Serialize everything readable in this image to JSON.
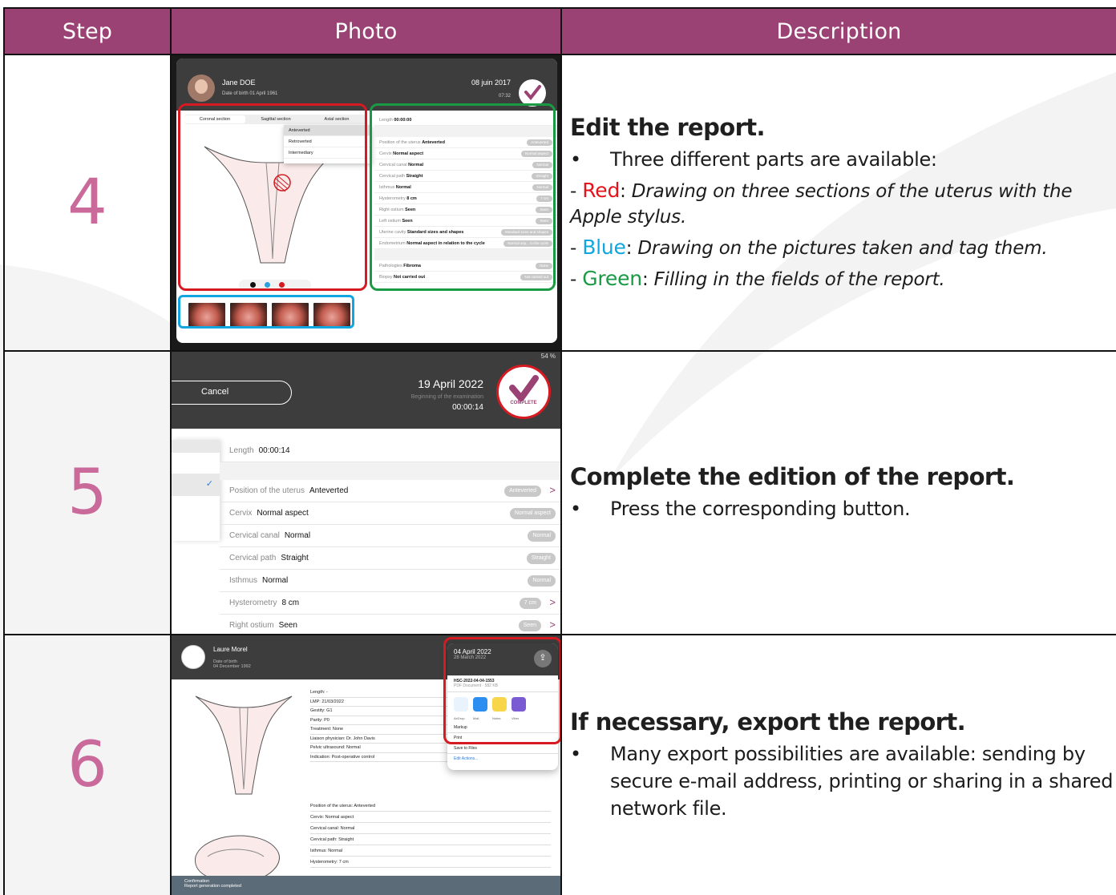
{
  "header": {
    "step": "Step",
    "photo": "Photo",
    "description": "Description"
  },
  "colors": {
    "header_bg": "#9b4274",
    "step_number": "#c96a9b",
    "red": "#e3141c",
    "blue": "#11a6df",
    "green": "#1a9a44"
  },
  "rows": [
    {
      "step": "4",
      "title": "Edit the report.",
      "bullet": "Three different parts are available:",
      "items": [
        {
          "keyword": "Red",
          "text": "Drawing on three sections of the uterus with the Apple stylus."
        },
        {
          "keyword": "Blue",
          "text": "Drawing on the pictures taken and tag them."
        },
        {
          "keyword": "Green",
          "text": "Filling in the fields of the report."
        }
      ],
      "screenshot": {
        "patient_name": "Jane DOE",
        "date_of_birth_label": "Date of birth",
        "date_of_birth": "01 April 1961",
        "exam_date": "08 juin 2017",
        "exam_time": "07:32",
        "tabs": [
          "Coronal section",
          "Sagittal section",
          "Axial section"
        ],
        "menu": [
          "Anteverted",
          "Retroverted",
          "Intermediary"
        ],
        "fields": [
          {
            "label": "Length",
            "value": "00:00:00",
            "pill": ""
          },
          {
            "label": "Position of the uterus",
            "value": "Anteverted",
            "pill": "Anteverted"
          },
          {
            "label": "Cervix",
            "value": "Normal aspect",
            "pill": "Normal aspect"
          },
          {
            "label": "Cervical canal",
            "value": "Normal",
            "pill": "Normal"
          },
          {
            "label": "Cervical path",
            "value": "Straight",
            "pill": "Straight"
          },
          {
            "label": "Isthmus",
            "value": "Normal",
            "pill": "Normal"
          },
          {
            "label": "Hysterometry",
            "value": "8 cm",
            "pill": "7 cm"
          },
          {
            "label": "Right ostium",
            "value": "Seen",
            "pill": "Seen"
          },
          {
            "label": "Left ostium",
            "value": "Seen",
            "pill": "Seen"
          },
          {
            "label": "Uterine cavity",
            "value": "Standard sizes and shapes",
            "pill": "Standard sizes and shapes"
          },
          {
            "label": "Endometrium",
            "value": "Normal aspect in relation to the cycle",
            "pill": "Normal asp... to the cycle"
          },
          {
            "label": "Pathologies",
            "value": "Fibroma",
            "pill": "None"
          },
          {
            "label": "Biopsy",
            "value": "Not carried out",
            "pill": "Not carried out"
          }
        ]
      }
    },
    {
      "step": "5",
      "title": "Complete the edition of the report.",
      "bullet": "Press the corresponding button.",
      "screenshot": {
        "status": "54 %",
        "cancel": "Cancel",
        "date": "19 April 2022",
        "sub": "Beginning of the examination",
        "time": "00:00:14",
        "complete": "COMPLETE",
        "fields": [
          {
            "label": "Length",
            "value": "00:00:14",
            "pill": ""
          },
          {
            "label": "Position of the uterus",
            "value": "Anteverted",
            "pill": "Anteverted"
          },
          {
            "label": "Cervix",
            "value": "Normal aspect",
            "pill": "Normal aspect"
          },
          {
            "label": "Cervical canal",
            "value": "Normal",
            "pill": "Normal"
          },
          {
            "label": "Cervical path",
            "value": "Straight",
            "pill": "Straight"
          },
          {
            "label": "Isthmus",
            "value": "Normal",
            "pill": "Normal"
          },
          {
            "label": "Hysterometry",
            "value": "8 cm",
            "pill": "7 cm"
          },
          {
            "label": "Right ostium",
            "value": "Seen",
            "pill": "Seen"
          }
        ]
      }
    },
    {
      "step": "6",
      "title": "If necessary, export the report.",
      "bullet": "Many export possibilities are available: sending by secure e-mail address, printing or sharing in a shared network file.",
      "screenshot": {
        "patient_name": "Laure Morel",
        "date_of_birth_label": "Date of birth",
        "date_of_birth": "04 December 1992",
        "sheet_date": "04 April 2022",
        "sheet_date2": "28 March 2022",
        "file_name": "HSC-2022-04-04-1553",
        "file_meta": "PDF Document · 582 KB",
        "apps": [
          "AirDrop",
          "Mail",
          "Notes",
          "Viber"
        ],
        "actions": [
          "Markup",
          "Print",
          "Save to Files",
          "Edit Actions..."
        ],
        "info": [
          "Length: -",
          "LMP: 21/03/2022",
          "Gestity: G1",
          "Parity: P0",
          "Treatment: None",
          "Liaison physician: Dr. John Davis",
          "Pelvic ultrasound: Normal",
          "Indication: Post-operative control"
        ],
        "info2": [
          "Position of the uterus: Anteverted",
          "Cervix: Normal aspect",
          "Cervical canal: Normal",
          "Cervical path: Straight",
          "Isthmus: Normal",
          "Hysterometry: 7 cm"
        ],
        "toast_title": "Confirmation",
        "toast_text": "Report generation completed"
      }
    }
  ]
}
